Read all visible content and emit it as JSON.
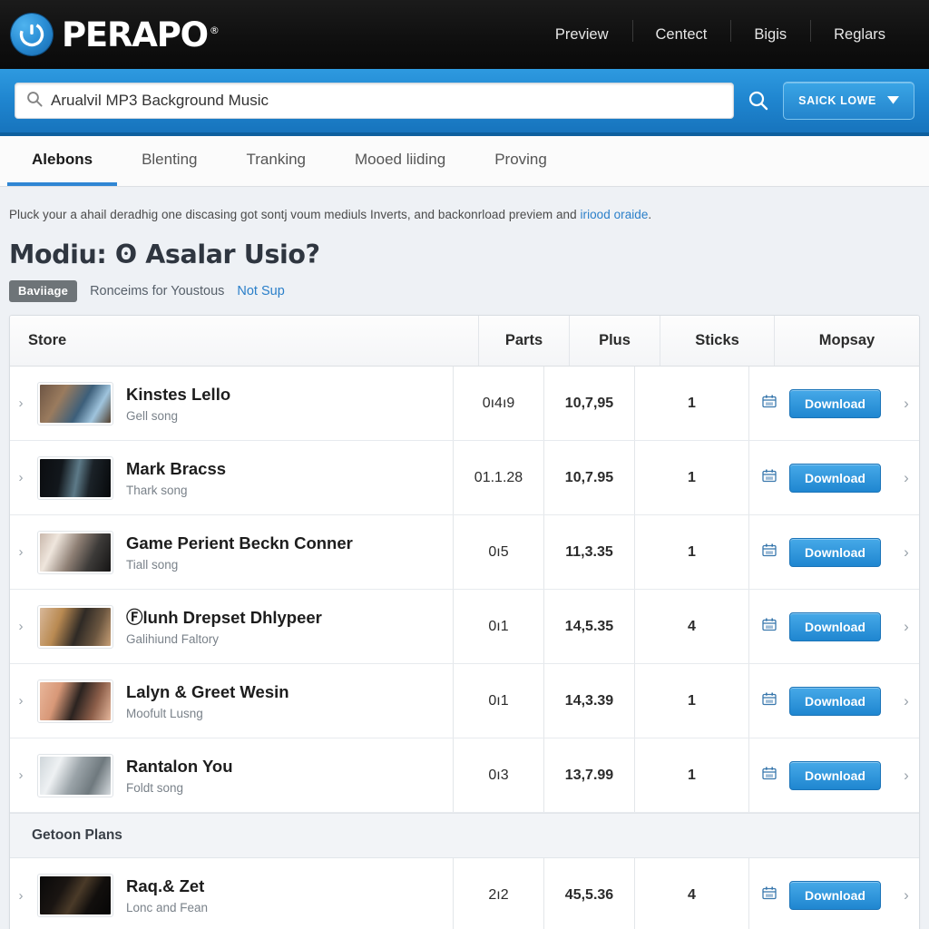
{
  "header": {
    "brand": "PERAPO",
    "brand_tm": "®",
    "logo_icon": "circle-power-logo-icon",
    "nav": [
      {
        "label": "Preview"
      },
      {
        "label": "Centect"
      },
      {
        "label": "Bigis"
      },
      {
        "label": "Reglars"
      }
    ]
  },
  "search": {
    "icon": "search-icon",
    "value": "Arualvil MP3 Background Music",
    "placeholder": "Arualvil MP3 Background Music",
    "go_icon": "search-submit-icon",
    "account_label": "SAICK LOWE",
    "account_caret_icon": "chevron-down-icon"
  },
  "tabs": [
    {
      "label": "Alebons",
      "active": true
    },
    {
      "label": "Blenting",
      "active": false
    },
    {
      "label": "Tranking",
      "active": false
    },
    {
      "label": "Mooed liiding",
      "active": false
    },
    {
      "label": "Proving",
      "active": false
    }
  ],
  "blurb": {
    "text": "Pluck your a ahail deradhig one discasing got sontj voum mediuls Inverts, and backonrload previem and ",
    "link": "iriood oraide",
    "tail": "."
  },
  "page_title": "Modiu: ʘ Asalar Usio?",
  "subrow": {
    "badge": "Baviiage",
    "muted": "Ronceims for Youstous",
    "link": "Not Sup"
  },
  "table": {
    "columns": [
      "Store",
      "Parts",
      "Plus",
      "Sticks",
      "Mopsay"
    ],
    "download_label": "Download",
    "row_caret_icon": "chevron-right-icon",
    "end_caret_icon": "chevron-right-icon",
    "mopsay_icon": "calendar-icon",
    "group_label": "Getoon Plans",
    "rows": [
      {
        "title": "Kinstes Lello",
        "sub": "Gell song",
        "parts": "0ı4ı9",
        "plus": "10,7,95",
        "sticks": "1",
        "thumb": "t1"
      },
      {
        "title": "Mark Bracss",
        "sub": "Thark song",
        "parts": "01.1.28",
        "plus": "10,7.95",
        "sticks": "1",
        "thumb": "t2"
      },
      {
        "title": "Game Perient Beckn Conner",
        "sub": "Tiall song",
        "parts": "0ı5",
        "plus": "11,3.35",
        "sticks": "1",
        "thumb": "t3"
      },
      {
        "title": "Ⓕlunh Drepset Dhlypeer",
        "sub": "Galihiund Faltory",
        "parts": "0ı1",
        "plus": "14,5.35",
        "sticks": "4",
        "thumb": "t4"
      },
      {
        "title": "Lalyn & Greet Wesin",
        "sub": "Moofult Lusng",
        "parts": "0ı1",
        "plus": "14,3.39",
        "sticks": "1",
        "thumb": "t5"
      },
      {
        "title": "Rantalon You",
        "sub": "Foldt song",
        "parts": "0ı3",
        "plus": "13,7.99",
        "sticks": "1",
        "thumb": "t6"
      }
    ],
    "group_rows": [
      {
        "title": "Raq.& Zet",
        "sub": "Lonc and Fean",
        "parts": "2ı2",
        "plus": "45,5.36",
        "sticks": "4",
        "thumb": "t7"
      }
    ]
  },
  "colors": {
    "brand_blue": "#2384cc",
    "band_blue": "#1f85cf",
    "tab_active": "#2f86d4",
    "link": "#2a7fc9",
    "badge_gray": "#6e7478",
    "topbar_black": "#101010"
  }
}
